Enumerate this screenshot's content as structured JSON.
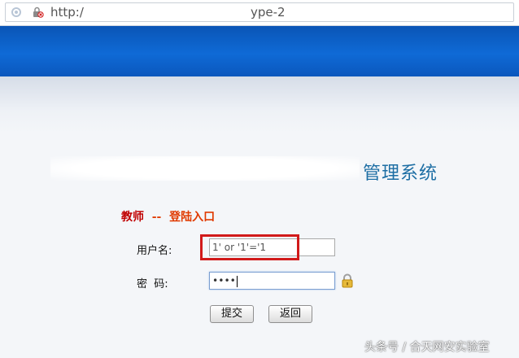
{
  "browser": {
    "url_prefix": "http:/",
    "url_suffix": "ype-2"
  },
  "page": {
    "system_title": "管理系统",
    "login_heading": {
      "role": "教师",
      "separator": "--",
      "entry": "登陆入口"
    }
  },
  "form": {
    "username_label": "用户名:",
    "username_value": "1' or '1'='1",
    "password_label": "密  码:",
    "password_masked": "••••",
    "submit_label": "提交",
    "back_label": "返回"
  },
  "watermark": "头条号 / 合天网安实验室",
  "colors": {
    "header_blue": "#0f6ad6",
    "title_blue": "#1d6ea4",
    "heading_red": "#c00000",
    "heading_orange": "#e03a00",
    "highlight_red": "#d11a1a"
  },
  "icons": [
    "refresh-icon",
    "insecure-lock-icon",
    "padlock-icon"
  ]
}
